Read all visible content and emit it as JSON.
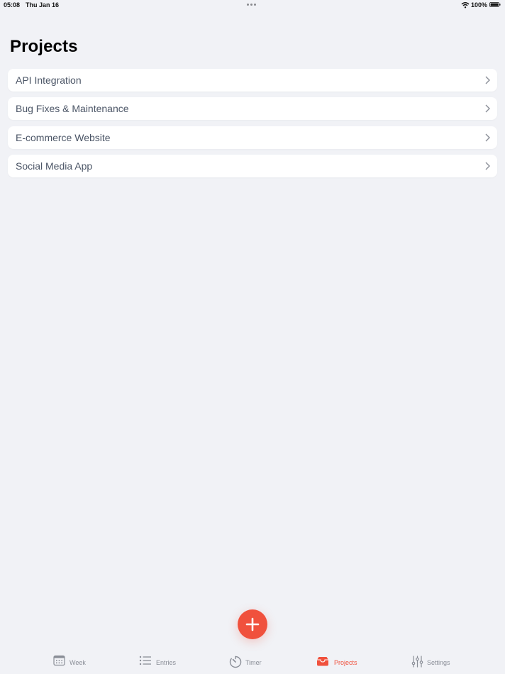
{
  "status_bar": {
    "time": "05:08",
    "date": "Thu Jan 16",
    "battery_percent": "100%"
  },
  "page": {
    "title": "Projects"
  },
  "projects": [
    {
      "name": "API Integration"
    },
    {
      "name": "Bug Fixes & Maintenance"
    },
    {
      "name": "E-commerce Website"
    },
    {
      "name": "Social Media App"
    }
  ],
  "tabs": [
    {
      "label": "Week",
      "icon": "calendar-icon",
      "active": false
    },
    {
      "label": "Entries",
      "icon": "list-icon",
      "active": false
    },
    {
      "label": "Timer",
      "icon": "timer-icon",
      "active": false
    },
    {
      "label": "Projects",
      "icon": "tray-icon",
      "active": true
    },
    {
      "label": "Settings",
      "icon": "sliders-icon",
      "active": false
    }
  ],
  "colors": {
    "accent": "#f0513d",
    "background": "#f1f2f6",
    "row_text": "#4b5566",
    "tab_inactive": "#8a8e97"
  }
}
